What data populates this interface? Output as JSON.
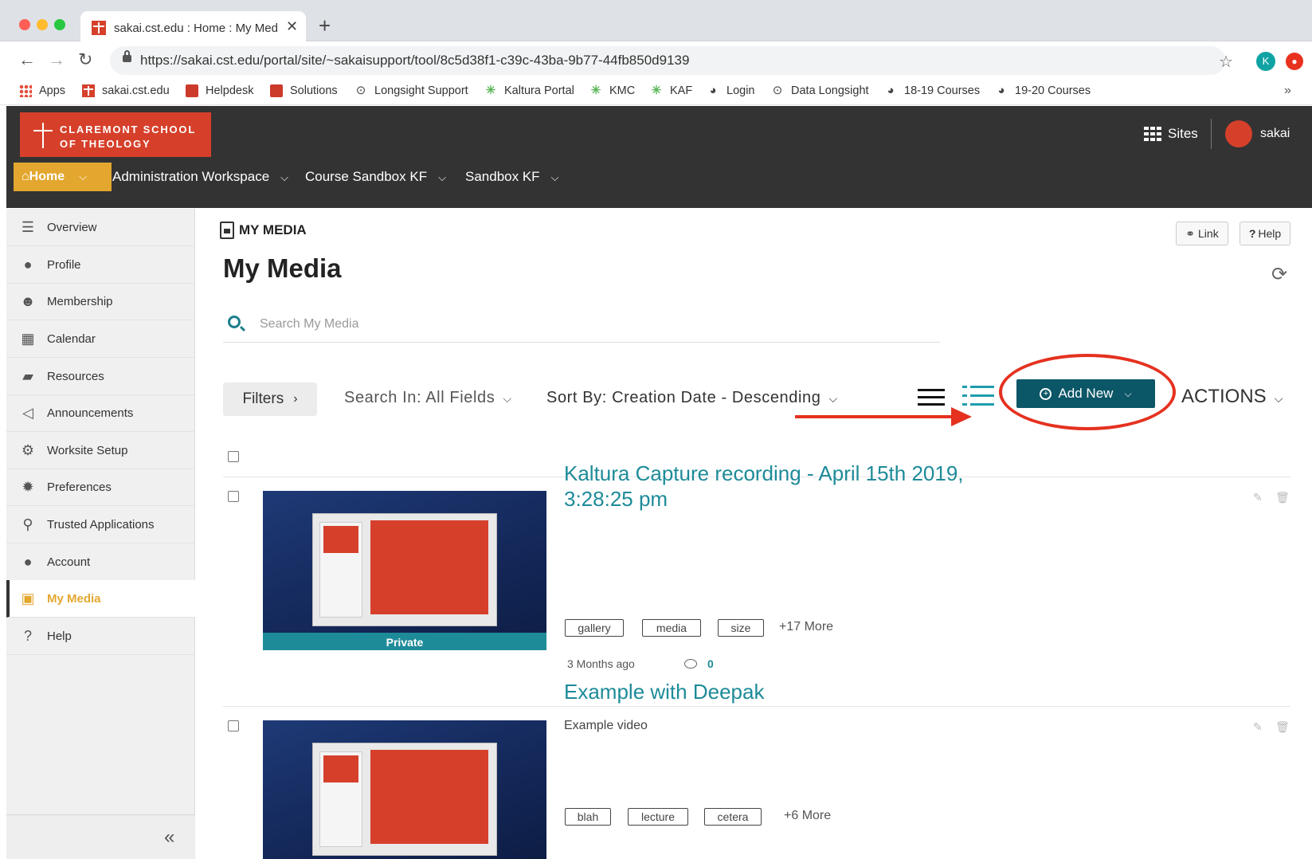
{
  "browser": {
    "tab_title": "sakai.cst.edu : Home : My Media",
    "tab_close": "✕",
    "new_tab": "+",
    "url": "https://sakai.cst.edu/portal/site/~sakaisupport/tool/8c5d38f1-c39c-43ba-9b77-44fb850d9139",
    "profile_initial": "K",
    "bookmarks": [
      {
        "label": "Apps",
        "icon": "apps-grid-icon"
      },
      {
        "label": "sakai.cst.edu",
        "icon": "cst-cross-icon"
      },
      {
        "label": "Helpdesk",
        "icon": "helpdesk-icon"
      },
      {
        "label": "Solutions",
        "icon": "solutions-icon"
      },
      {
        "label": "Longsight Support",
        "icon": "longsight-icon"
      },
      {
        "label": "Kaltura Portal",
        "icon": "kaltura-star-icon"
      },
      {
        "label": "KMC",
        "icon": "kaltura-star-icon"
      },
      {
        "label": "KAF",
        "icon": "kaltura-star-icon"
      },
      {
        "label": "Login",
        "icon": "globe-icon"
      },
      {
        "label": "Data Longsight",
        "icon": "longsight-icon"
      },
      {
        "label": "18-19 Courses",
        "icon": "globe-icon"
      },
      {
        "label": "19-20 Courses",
        "icon": "globe-icon"
      }
    ],
    "bookmarks_overflow": "»"
  },
  "portal": {
    "logo_line1": "CLAREMONT SCHOOL",
    "logo_line2": "OF THEOLOGY",
    "sites_label": "Sites",
    "user_label": "sakai",
    "brand_color": "#d6402b",
    "home_color": "#e3a72f",
    "site_tabs": [
      {
        "label": "Home"
      },
      {
        "label": "Administration Workspace"
      },
      {
        "label": "Course Sandbox KF"
      },
      {
        "label": "Sandbox KF"
      }
    ]
  },
  "toolmenu": {
    "items": [
      {
        "label": "Overview",
        "icon": "list-icon"
      },
      {
        "label": "Profile",
        "icon": "user-icon"
      },
      {
        "label": "Membership",
        "icon": "users-icon"
      },
      {
        "label": "Calendar",
        "icon": "calendar-icon"
      },
      {
        "label": "Resources",
        "icon": "folder-icon"
      },
      {
        "label": "Announcements",
        "icon": "megaphone-icon"
      },
      {
        "label": "Worksite Setup",
        "icon": "gears-icon"
      },
      {
        "label": "Preferences",
        "icon": "gear-icon"
      },
      {
        "label": "Trusted Applications",
        "icon": "key-icon"
      },
      {
        "label": "Account",
        "icon": "user-icon"
      },
      {
        "label": "My Media",
        "icon": "media-file-icon"
      },
      {
        "label": "Help",
        "icon": "question-icon"
      }
    ],
    "active": "My Media",
    "collapse": "«"
  },
  "main": {
    "tool_title": "MY MEDIA",
    "link_btn": "Link",
    "help_btn": "Help",
    "heading": "My Media",
    "search_placeholder": "Search My Media",
    "filters_label": "Filters",
    "search_in": "Search In: All Fields",
    "sort_by": "Sort By: Creation Date - Descending",
    "add_new": "Add New",
    "actions": "ACTIONS",
    "accent_color": "#1e8b99",
    "button_color": "#0b5667",
    "annotation_color": "#e5311f",
    "entries": [
      {
        "title": "Kaltura Capture recording - April 15th 2019, 3:28:25 pm",
        "description": "",
        "privacy": "Private",
        "tags": [
          "gallery",
          "media",
          "size"
        ],
        "more_tags": "+17 More",
        "date": "3 Months ago",
        "comments": "0"
      },
      {
        "title": "Example with Deepak",
        "description": "Example video",
        "privacy": "",
        "tags": [
          "blah",
          "lecture",
          "cetera"
        ],
        "more_tags": "+6 More",
        "date": "",
        "comments": ""
      }
    ]
  }
}
